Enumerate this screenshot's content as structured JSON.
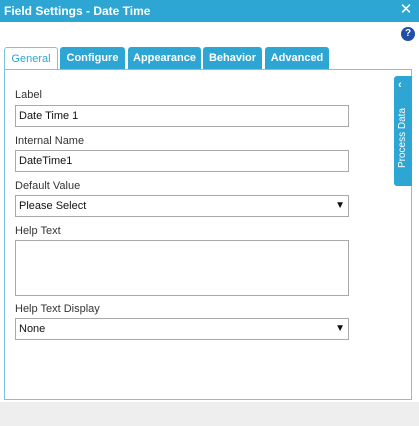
{
  "window": {
    "title": "Field Settings - Date Time",
    "close_icon": "close-icon"
  },
  "help_icon": "?",
  "tabs": [
    {
      "label": "General",
      "active": true
    },
    {
      "label": "Configure"
    },
    {
      "label": "Appearance"
    },
    {
      "label": "Behavior"
    },
    {
      "label": "Advanced"
    }
  ],
  "form": {
    "label": {
      "caption": "Label",
      "value": "Date Time 1"
    },
    "internal_name": {
      "caption": "Internal Name",
      "value": "DateTime1"
    },
    "default_value": {
      "caption": "Default Value",
      "value": "Please Select"
    },
    "help_text": {
      "caption": "Help Text",
      "value": ""
    },
    "help_text_display": {
      "caption": "Help Text Display",
      "value": "None"
    }
  },
  "side_panel": {
    "label": "Process Data"
  },
  "colors": {
    "accent": "#2ea6d3",
    "help": "#1f4fa8"
  }
}
